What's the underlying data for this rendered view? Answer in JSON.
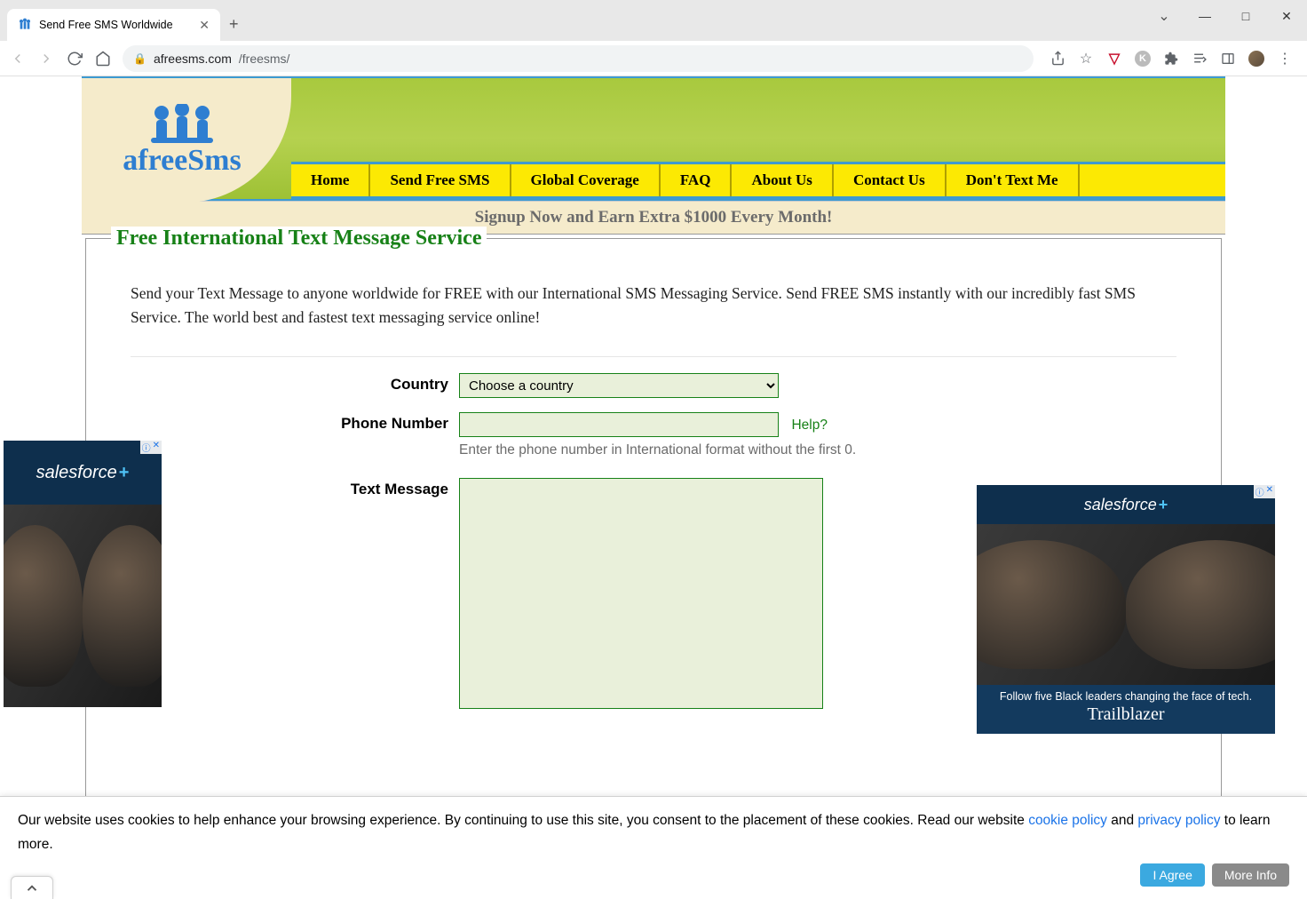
{
  "browser": {
    "tab_title": "Send Free SMS Worldwide",
    "url_host": "afreesms.com",
    "url_path": "/freesms/"
  },
  "nav": {
    "items": [
      "Home",
      "Send Free SMS",
      "Global Coverage",
      "FAQ",
      "About Us",
      "Contact Us",
      "Don't Text Me"
    ]
  },
  "signup_banner": "Signup Now and Earn Extra $1000 Every Month!",
  "page_title": "Free International Text Message Service",
  "intro": "Send your Text Message to anyone worldwide for FREE with our International SMS Messaging Service. Send FREE SMS instantly with our incredibly fast SMS Service. The world best and fastest text messaging service online!",
  "form": {
    "country_label": "Country",
    "country_selected": "Choose a country",
    "phone_label": "Phone Number",
    "phone_value": "",
    "help_link": "Help?",
    "phone_hint": "Enter the phone number in International format without the first 0.",
    "message_label": "Text Message",
    "message_value": ""
  },
  "ads": {
    "brand": "salesforce",
    "tagline": "Follow five Black leaders changing the face of tech.",
    "script": "Trailblazer"
  },
  "cookie": {
    "text_1": "Our website uses cookies to help enhance your browsing experience. By continuing to use this site, you consent to the placement of these cookies. Read our website ",
    "link_1": "cookie policy",
    "text_2": " and ",
    "link_2": "privacy policy",
    "text_3": " to learn more.",
    "agree": "I Agree",
    "more": "More Info"
  }
}
